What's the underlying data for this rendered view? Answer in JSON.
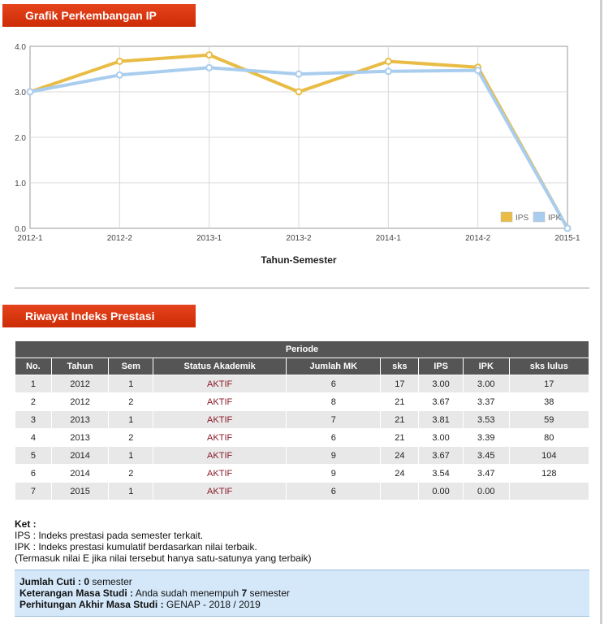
{
  "section1": {
    "title": "Grafik Perkembangan IP"
  },
  "section2": {
    "title": "Riwayat Indeks Prestasi"
  },
  "chart_data": {
    "type": "line",
    "categories": [
      "2012-1",
      "2012-2",
      "2013-1",
      "2013-2",
      "2014-1",
      "2014-2",
      "2015-1"
    ],
    "series": [
      {
        "name": "IPS",
        "values": [
          3.0,
          3.67,
          3.81,
          3.0,
          3.67,
          3.54,
          0.0
        ],
        "color": "#e8bc45"
      },
      {
        "name": "IPK",
        "values": [
          3.0,
          3.37,
          3.53,
          3.39,
          3.45,
          3.47,
          0.0
        ],
        "color": "#a9cdee"
      }
    ],
    "xlabel": "Tahun-Semester",
    "ylabel": "",
    "ylim": [
      0,
      4
    ],
    "yticks": [
      "0.0",
      "1.0",
      "2.0",
      "3.0",
      "4.0"
    ],
    "grid": true,
    "legend": "bottom-right"
  },
  "table": {
    "group_header": "Periode",
    "headers": [
      "No.",
      "Tahun",
      "Sem",
      "Status Akademik",
      "Jumlah MK",
      "sks",
      "IPS",
      "IPK",
      "sks lulus"
    ],
    "rows": [
      [
        "1",
        "2012",
        "1",
        "AKTIF",
        "6",
        "17",
        "3.00",
        "3.00",
        "17"
      ],
      [
        "2",
        "2012",
        "2",
        "AKTIF",
        "8",
        "21",
        "3.67",
        "3.37",
        "38"
      ],
      [
        "3",
        "2013",
        "1",
        "AKTIF",
        "7",
        "21",
        "3.81",
        "3.53",
        "59"
      ],
      [
        "4",
        "2013",
        "2",
        "AKTIF",
        "6",
        "21",
        "3.00",
        "3.39",
        "80"
      ],
      [
        "5",
        "2014",
        "1",
        "AKTIF",
        "9",
        "24",
        "3.67",
        "3.45",
        "104"
      ],
      [
        "6",
        "2014",
        "2",
        "AKTIF",
        "9",
        "24",
        "3.54",
        "3.47",
        "128"
      ],
      [
        "7",
        "2015",
        "1",
        "AKTIF",
        "6",
        "",
        "0.00",
        "0.00",
        ""
      ]
    ]
  },
  "notes": {
    "title": "Ket :",
    "lines": [
      "IPS : Indeks prestasi pada semester terkait.",
      "IPK : Indeks prestasi kumulatif berdasarkan nilai terbaik.",
      "(Termasuk nilai E jika nilai tersebut hanya satu-satunya yang terbaik)"
    ]
  },
  "info": {
    "cuti_label": "Jumlah Cuti :",
    "cuti_value": "0",
    "cuti_suffix": "semester",
    "ket_label": "Keterangan Masa Studi :",
    "ket_prefix": "Anda sudah menempuh",
    "ket_value": "7",
    "ket_suffix": "semester",
    "akhir_label": "Perhitungan Akhir Masa Studi :",
    "akhir_value": "GENAP - 2018 / 2019"
  }
}
